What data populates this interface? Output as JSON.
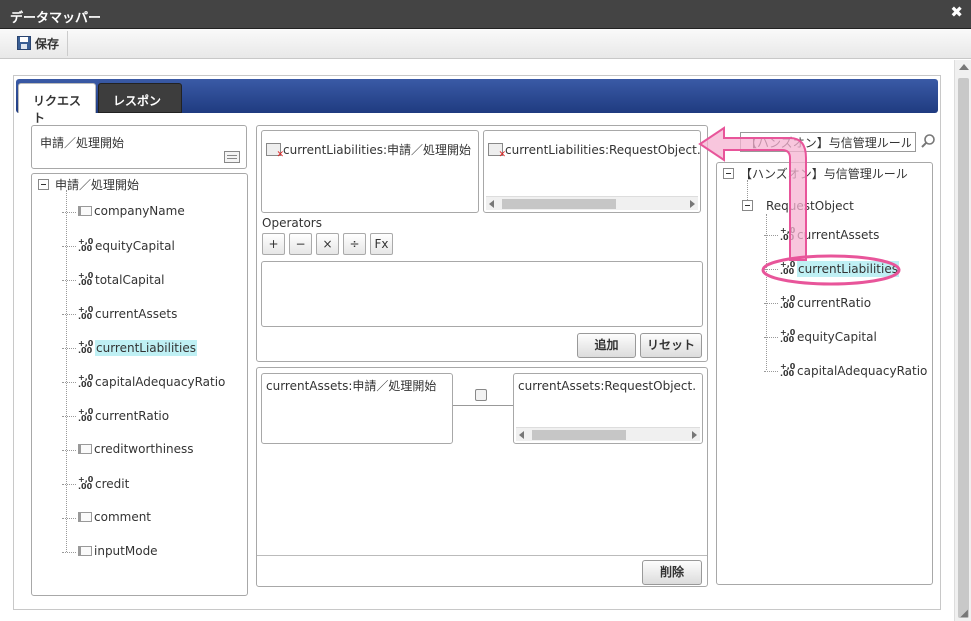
{
  "window": {
    "title": "データマッパー"
  },
  "toolbar": {
    "save_label": "保存"
  },
  "tabs": [
    {
      "label": "リクエスト",
      "active": true
    },
    {
      "label": "レスポンス",
      "active": false
    }
  ],
  "request_panel": {
    "title": "申請／処理開始",
    "tree": {
      "root": "申請／処理開始",
      "items": [
        {
          "label": "companyName",
          "type": "string"
        },
        {
          "label": "equityCapital",
          "type": "number"
        },
        {
          "label": "totalCapital",
          "type": "number"
        },
        {
          "label": "currentAssets",
          "type": "number"
        },
        {
          "label": "currentLiabilities",
          "type": "number",
          "selected": true
        },
        {
          "label": "capitalAdequacyRatio",
          "type": "number"
        },
        {
          "label": "currentRatio",
          "type": "number"
        },
        {
          "label": "creditworthiness",
          "type": "string"
        },
        {
          "label": "credit",
          "type": "number"
        },
        {
          "label": "comment",
          "type": "string"
        },
        {
          "label": "inputMode",
          "type": "string"
        }
      ]
    }
  },
  "mapping_editor": {
    "source_field": "currentLiabilities:申請／処理開始",
    "target_field": "currentLiabilities:RequestObject.【ハン",
    "operators_label": "Operators",
    "operators": [
      "+",
      "−",
      "×",
      "÷",
      "Fx"
    ],
    "add_button": "追加",
    "reset_button": "リセット"
  },
  "mapping_list": {
    "source": "currentAssets:申請／処理開始",
    "target": "currentAssets:RequestObject.【ハン",
    "delete_button": "削除"
  },
  "response_panel": {
    "search_value": "【ハンズオン】与信管理ルール",
    "tree": {
      "root": "【ハンズオン】与信管理ルール",
      "object": "RequestObject",
      "items": [
        {
          "label": "currentAssets",
          "type": "number"
        },
        {
          "label": "currentLiabilities",
          "type": "number",
          "selected": true
        },
        {
          "label": "currentRatio",
          "type": "number"
        },
        {
          "label": "equityCapital",
          "type": "number"
        },
        {
          "label": "capitalAdequacyRatio",
          "type": "number"
        }
      ]
    }
  },
  "icons": {
    "number_glyph": "+,0\n.00",
    "close_glyph": "✖"
  },
  "colors": {
    "titlebar": "#444444",
    "tab_active_bar": "#1f3b80",
    "selection": "#bff0f4",
    "annotation": "#e8559a"
  }
}
